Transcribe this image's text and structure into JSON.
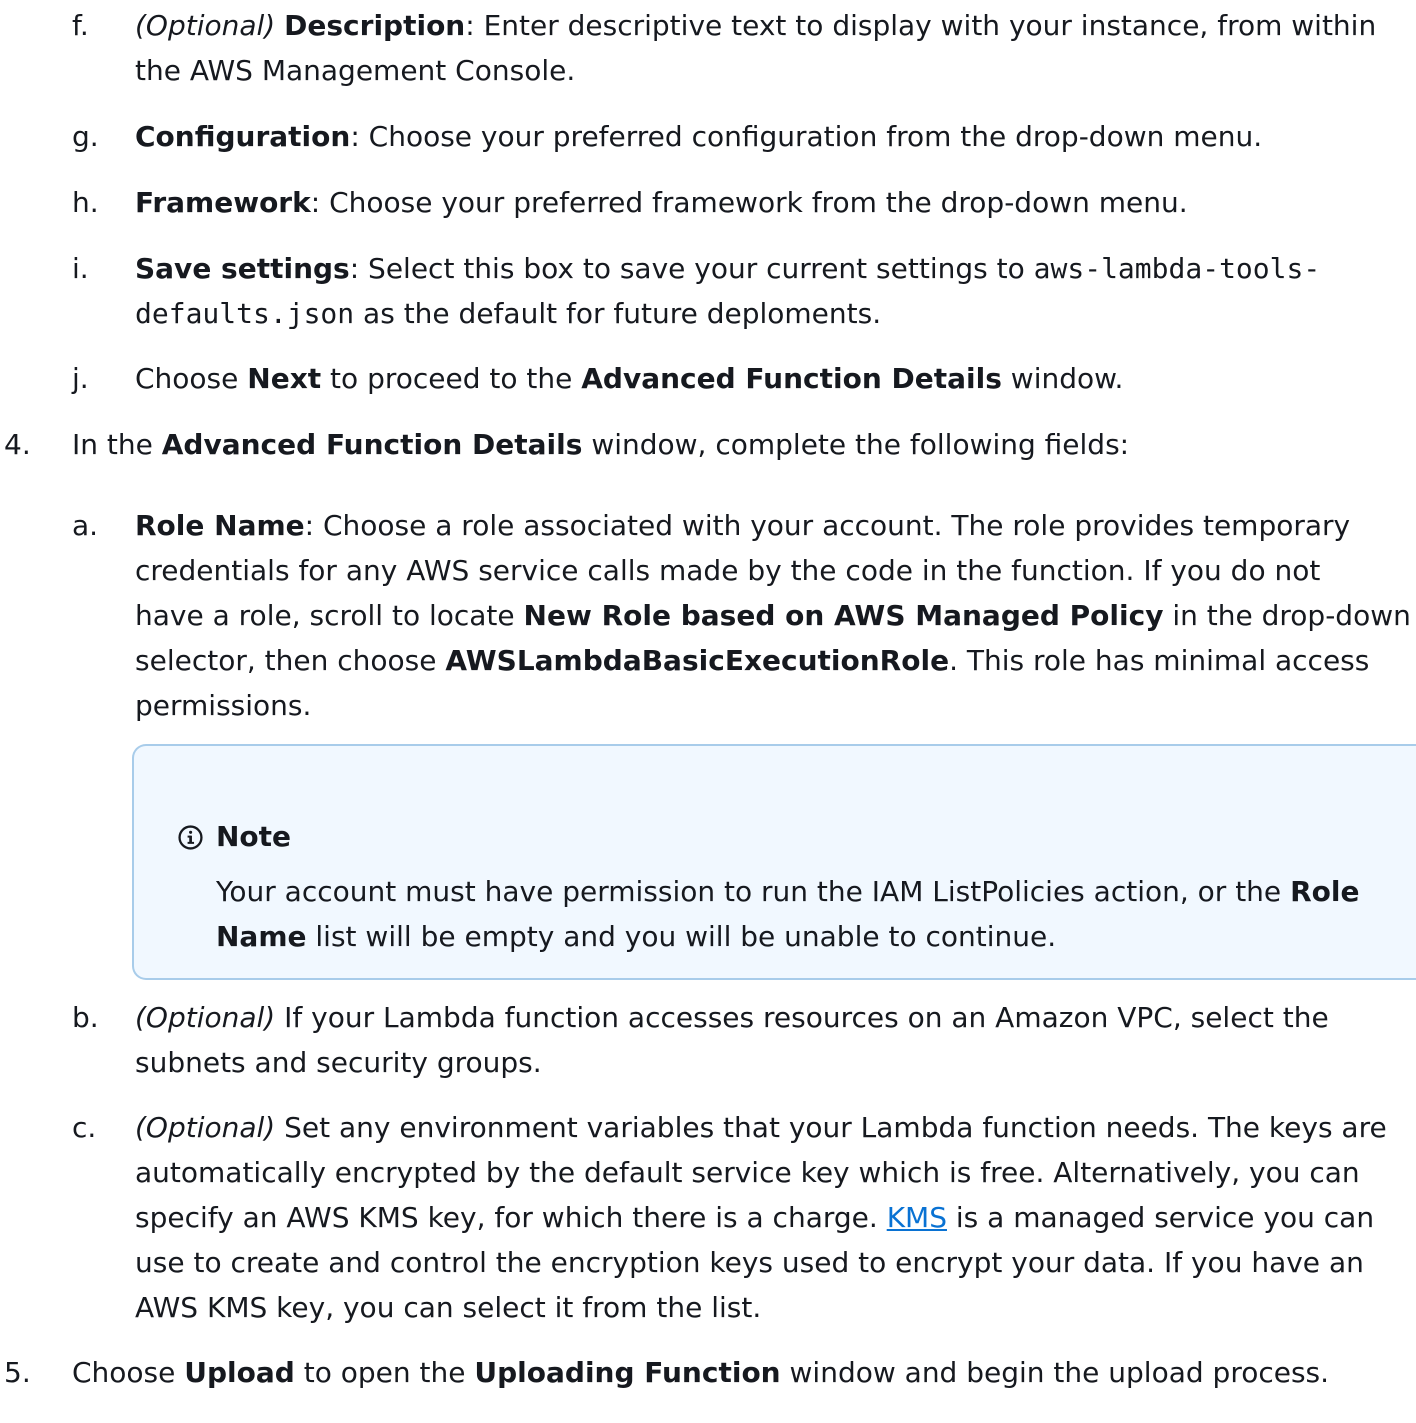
{
  "steps": {
    "f": {
      "marker": "f.",
      "optional": "(Optional)",
      "term": "Description",
      "text_line1": ": Enter descriptive text to display with your instance, from within",
      "text_line2": "the AWS Management Console."
    },
    "g": {
      "marker": "g.",
      "term": "Configuration",
      "text": ": Choose your preferred configuration from the drop-down menu."
    },
    "h": {
      "marker": "h.",
      "term": "Framework",
      "text": ": Choose your preferred framework from the drop-down menu."
    },
    "i": {
      "marker": "i.",
      "term": "Save settings",
      "text_a": ": Select this box to save your current settings to ",
      "code_a": "aws-lambda-tools-",
      "code_b": "defaults.json",
      "text_b": " as the default for future deploments."
    },
    "j": {
      "marker": "j.",
      "text_a": "Choose ",
      "term_a": "Next",
      "text_b": " to proceed to the ",
      "term_b": "Advanced Function Details",
      "text_c": " window."
    },
    "four": {
      "marker": "4.",
      "text_a": "In the ",
      "term": "Advanced Function Details",
      "text_b": " window, complete the following fields:"
    },
    "a": {
      "marker": "a.",
      "term": "Role Name",
      "line1": ": Choose a role associated with your account. The role provides temporary",
      "line2": "credentials for any AWS service calls made by the code in the function. If you do not",
      "line3_a": "have a role, scroll to locate ",
      "line3_term": "New Role based on AWS Managed Policy",
      "line3_b": " in the drop-down",
      "line4_a": "selector, then choose ",
      "line4_term": "AWSLambdaBasicExecutionRole",
      "line4_b": ". This role has minimal access",
      "line5": "permissions."
    },
    "note": {
      "title": "Note",
      "line1_a": "Your account must have permission to run the IAM ListPolicies action, or the ",
      "line1_term": "Role",
      "line2_term": "Name",
      "line2_b": " list will be empty and you will be unable to continue."
    },
    "b": {
      "marker": "b.",
      "optional": "(Optional)",
      "line1": " If your Lambda function accesses resources on an Amazon VPC, select the",
      "line2": "subnets and security groups."
    },
    "c": {
      "marker": "c.",
      "optional": "(Optional)",
      "line1": " Set any environment variables that your Lambda function needs. The keys are",
      "line2": "automatically encrypted by the default service key which is free. Alternatively, you can",
      "line3_a": "specify an AWS KMS key, for which there is a charge. ",
      "line3_link": "KMS",
      "line3_b": " is a managed service you can",
      "line4": "use to create and control the encryption keys used to encrypt your data. If you have an",
      "line5": "AWS KMS key, you can select it from the list."
    },
    "five": {
      "marker": "5.",
      "text_a": "Choose ",
      "term_a": "Upload",
      "text_b": " to open the ",
      "term_b": "Uploading Function",
      "text_c": " window and begin the upload process."
    }
  },
  "colors": {
    "text": "#16191f",
    "link": "#0972d3",
    "note_background": "#f1f8ff",
    "note_border": "#a8ccea",
    "info_icon": "#16191f"
  },
  "icons": {
    "note": "info-circle-icon"
  }
}
